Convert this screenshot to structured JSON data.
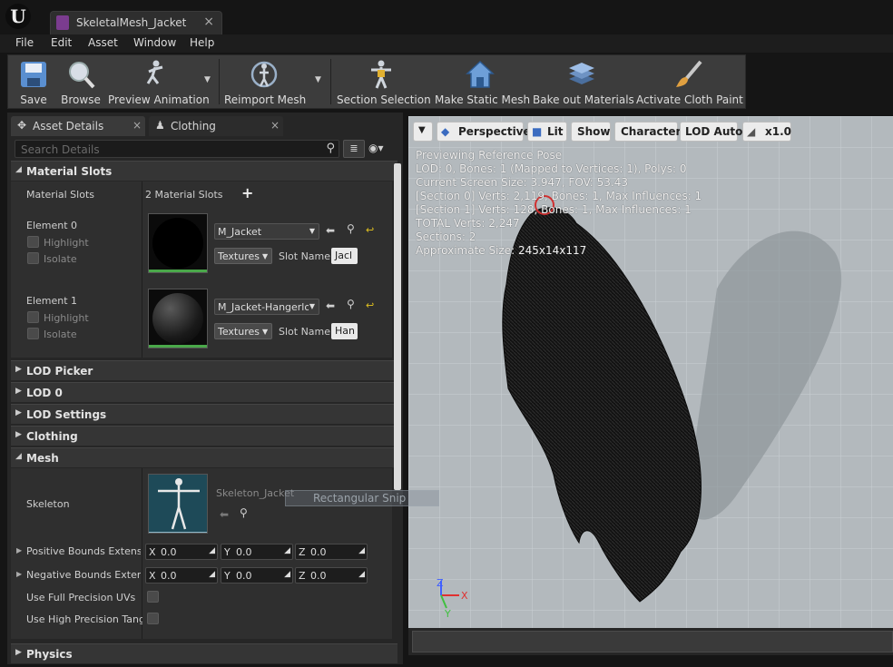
{
  "window": {
    "tab_title": "SkeletalMesh_Jacket",
    "close": "×"
  },
  "menu": [
    "File",
    "Edit",
    "Asset",
    "Window",
    "Help"
  ],
  "toolbar": [
    {
      "label": "Save",
      "icon": "save-icon"
    },
    {
      "label": "Browse",
      "icon": "browse-icon"
    },
    {
      "label": "Preview Animation",
      "icon": "preview-animation-icon"
    },
    {
      "label": "Reimport Mesh",
      "icon": "reimport-mesh-icon"
    },
    {
      "label": "Section Selection",
      "icon": "section-selection-icon"
    },
    {
      "label": "Make Static Mesh",
      "icon": "make-static-mesh-icon"
    },
    {
      "label": "Bake out Materials",
      "icon": "bake-out-materials-icon"
    },
    {
      "label": "Activate Cloth Paint",
      "icon": "cloth-paint-icon"
    }
  ],
  "panel": {
    "tabs": [
      {
        "label": "Asset Details"
      },
      {
        "label": "Clothing"
      }
    ],
    "close": "×",
    "search_placeholder": "Search Details",
    "sections": {
      "material_slots": "Material Slots",
      "lod_picker": "LOD Picker",
      "lod0": "LOD 0",
      "lod_settings": "LOD Settings",
      "clothing": "Clothing",
      "mesh": "Mesh",
      "physics": "Physics"
    },
    "material_slots": {
      "label": "Material Slots",
      "count_text": "2 Material Slots",
      "highlight_label": "Highlight",
      "isolate_label": "Isolate",
      "textures_label": "Textures",
      "slot_name_label": "Slot Name",
      "elements": [
        {
          "label": "Element 0",
          "material": "M_Jacket",
          "slot_name": "Jacl"
        },
        {
          "label": "Element 1",
          "material": "M_Jacket-Hangerloo",
          "slot_name": "Han"
        }
      ]
    },
    "mesh": {
      "skeleton_label": "Skeleton",
      "skeleton_value": "Skeleton_Jacket",
      "positive_bounds_label": "Positive Bounds Extensic",
      "negative_bounds_label": "Negative Bounds Extensi",
      "positive_bounds": [
        {
          "axis": "X",
          "value": "0.0"
        },
        {
          "axis": "Y",
          "value": "0.0"
        },
        {
          "axis": "Z",
          "value": "0.0"
        }
      ],
      "negative_bounds": [
        {
          "axis": "X",
          "value": "0.0"
        },
        {
          "axis": "Y",
          "value": "0.0"
        },
        {
          "axis": "Z",
          "value": "0.0"
        }
      ],
      "full_precision_uvs_label": "Use Full Precision UVs",
      "high_precision_label": "Use High Precision Tange"
    }
  },
  "viewport": {
    "buttons": [
      "Perspective",
      "Lit",
      "Show",
      "Character",
      "LOD Auto",
      "x1.0"
    ],
    "info": [
      "Previewing Reference Pose",
      "LOD: 0, Bones: 1 (Mapped to Vertices: 1), Polys: 0",
      "Current Screen Size: 3.947, FOV: 53.43",
      " [Section 0] Verts: 2,119, Bones: 1, Max Influences: 1",
      " [Section 1] Verts: 128, Bones: 1, Max Influences: 1",
      "TOTAL Verts: 2,247",
      "Sections: 2",
      "Approximate Size: 245x14x117"
    ],
    "axis": {
      "x": "X",
      "y": "Y",
      "z": "Z"
    },
    "snip_label": "Rectangular Snip"
  },
  "colors": {
    "accent_green": "#4aa84a",
    "viewport_bg": "#aab0b5",
    "axis_x": "#e03030",
    "axis_y": "#40c040",
    "axis_z": "#4060ff"
  }
}
